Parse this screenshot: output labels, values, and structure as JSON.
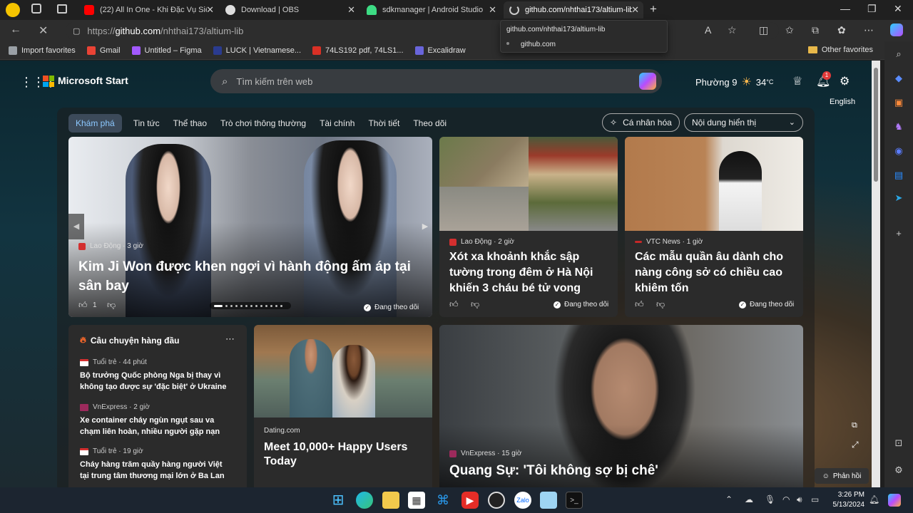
{
  "tabs": [
    {
      "title": "(22) All In One - Khi Đặc Vụ Siêu",
      "icon_color": "#ff0000",
      "icon": "youtube-icon"
    },
    {
      "title": "Download | OBS",
      "icon_color": "#ffffff",
      "icon": "obs-icon"
    },
    {
      "title": "sdkmanager | Android Studio",
      "icon_color": "#3ddc84",
      "icon": "android-icon"
    },
    {
      "title": "github.com/nhthai173/altium-lib",
      "icon_color": "#cccccc",
      "icon": "loading-icon",
      "active": true
    }
  ],
  "address": {
    "scheme": "https://",
    "host": "github.com",
    "path": "/nhthai173/altium-lib"
  },
  "url_dropdown": {
    "line1": "github.com/nhthai173/altium-lib",
    "line2": "github.com"
  },
  "bookmarks": [
    {
      "label": "Import favorites",
      "color": "#9aa0a6"
    },
    {
      "label": "Gmail",
      "color": "#ea4335"
    },
    {
      "label": "Untitled – Figma",
      "color": "#a259ff"
    },
    {
      "label": "LUCK | Vietnamese...",
      "color": "#2a3b8f"
    },
    {
      "label": "74LS192 pdf, 74LS1...",
      "color": "#d93025"
    },
    {
      "label": "Excalidraw",
      "color": "#6965db"
    }
  ],
  "other_favorites": "Other favorites",
  "msn": {
    "brand": "Microsoft Start",
    "search_placeholder": "Tìm kiếm trên web",
    "location": "Phường 9",
    "temperature": "34",
    "temp_unit": "°C",
    "notification_count": "1",
    "language_link": "English",
    "nav": [
      "Khám phá",
      "Tin tức",
      "Thể thao",
      "Trò chơi thông thường",
      "Tài chính",
      "Thời tiết",
      "Theo dõi"
    ],
    "personalize": "Cá nhân hóa",
    "content_visible": "Nội dung hiển thị"
  },
  "hero": {
    "source": "Lao Động",
    "time": "3 giờ",
    "headline": "Kim Ji Won được khen ngợi vì hành động ấm áp tại sân bay",
    "likes": "1",
    "follow": "Đang theo dõi"
  },
  "card2": {
    "source": "Lao Động",
    "time": "2 giờ",
    "headline": "Xót xa khoảnh khắc sập tường trong đêm ở Hà Nội khiến 3 cháu bé tử vong",
    "follow": "Đang theo dõi"
  },
  "card3": {
    "source": "VTC News",
    "time": "1 giờ",
    "headline": "Các mẫu quần âu dành cho nàng công sở có chiều cao khiêm tốn",
    "follow": "Đang theo dõi"
  },
  "top_stories": {
    "title": "Câu chuyện hàng đầu",
    "items": [
      {
        "source": "Tuổi trẻ",
        "time": "44 phút",
        "text": "Bộ trưởng Quốc phòng Nga bị thay vì không tạo được sự 'đặc biệt' ở Ukraine"
      },
      {
        "source": "VnExpress",
        "time": "2 giờ",
        "text": "Xe container cháy ngùn ngụt sau va chạm liên hoàn, nhiều người gặp nạn"
      },
      {
        "source": "Tuổi trẻ",
        "time": "19 giờ",
        "text": "Cháy hàng trăm quầy hàng người Việt tại trung tâm thương mại lớn ở Ba Lan"
      }
    ]
  },
  "ad_card": {
    "source": "Dating.com",
    "headline": "Meet 10,000+ Happy Users Today"
  },
  "video_card": {
    "source": "VnExpress",
    "time": "15 giờ",
    "headline": "Quang Sự: 'Tôi không sợ bị chê'"
  },
  "feedback": "Phản hồi",
  "clock": {
    "time": "3:26 PM",
    "date": "5/13/2024"
  }
}
